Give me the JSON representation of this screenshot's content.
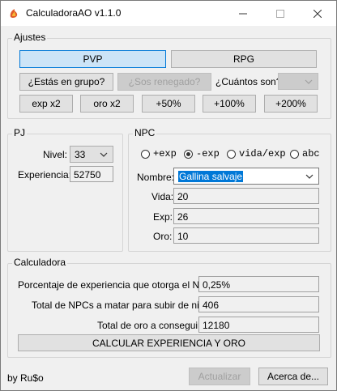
{
  "window": {
    "title": "CalculadoraAO v1.1.0"
  },
  "ajustes": {
    "label": "Ajustes",
    "pvp_label": "PVP",
    "rpg_label": "RPG",
    "grupo_label": "¿Estás en grupo?",
    "renegado_label": "¿Sos renegado?",
    "cuantos_label": "¿Cuántos son?",
    "cuantos_value": "",
    "exp_x2_label": "exp x2",
    "oro_x2_label": "oro x2",
    "plus50_label": "+50%",
    "plus100_label": "+100%",
    "plus200_label": "+200%"
  },
  "pj": {
    "label": "PJ",
    "nivel_label": "Nivel:",
    "nivel_value": "33",
    "experiencia_label": "Experiencia:",
    "experiencia_value": "52750"
  },
  "npc": {
    "label": "NPC",
    "sort_options": [
      "+exp",
      "-exp",
      "vida/exp",
      "abc"
    ],
    "selected_sort": "-exp",
    "nombre_label": "Nombre:",
    "nombre_value": "Gallina salvaje",
    "vida_label": "Vida:",
    "vida_value": "20",
    "exp_label": "Exp:",
    "exp_value": "26",
    "oro_label": "Oro:",
    "oro_value": "10"
  },
  "calculadora": {
    "label": "Calculadora",
    "porcentaje_label": "Porcentaje de experiencia que otorga el NPC:",
    "porcentaje_value": "0,25%",
    "total_npcs_label": "Total de NPCs a matar para subir de nivel:",
    "total_npcs_value": "406",
    "total_oro_label": "Total de oro a conseguir:",
    "total_oro_value": "12180",
    "calc_button_label": "CALCULAR EXPERIENCIA Y ORO"
  },
  "footer": {
    "author": "by Ru$o",
    "actualizar_label": "Actualizar",
    "acerca_label": "Acerca de..."
  },
  "colors": {
    "accent": "#0078d7",
    "selected_bg": "#cce4f7",
    "button_bg": "#e1e1e1"
  },
  "icons": [
    "app-icon",
    "minimize-icon",
    "maximize-icon",
    "close-icon",
    "chevron-down-icon"
  ]
}
